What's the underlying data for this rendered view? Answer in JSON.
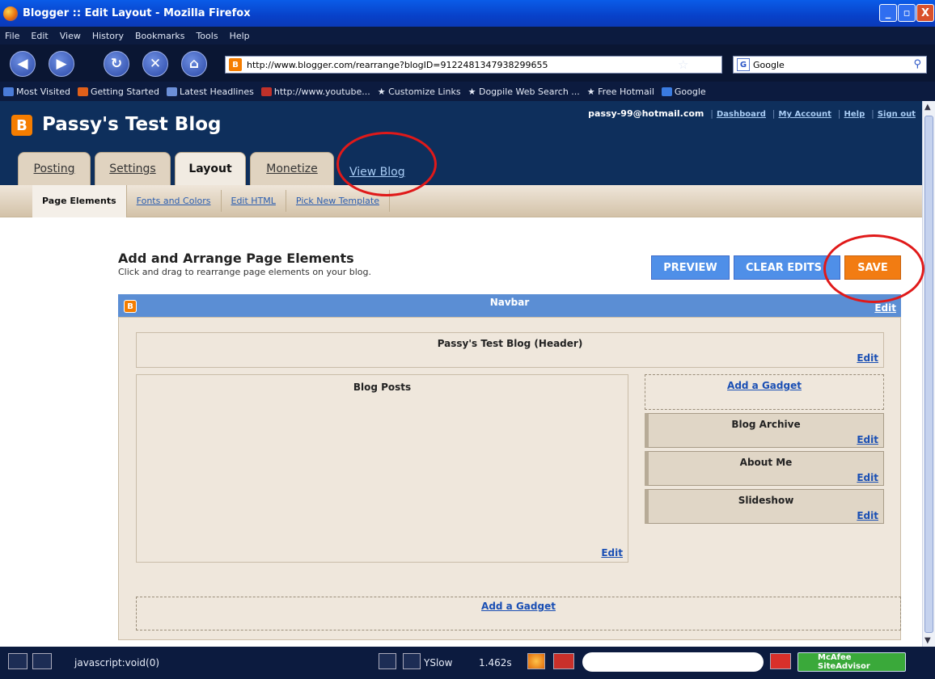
{
  "window": {
    "title": "Blogger :: Edit Layout - Mozilla Firefox",
    "controls": [
      "_",
      "▫",
      "X"
    ]
  },
  "menu": [
    "File",
    "Edit",
    "View",
    "History",
    "Bookmarks",
    "Tools",
    "Help"
  ],
  "nav": {
    "url": "http://www.blogger.com/rearrange?blogID=9122481347938299655",
    "search_engine": "Google"
  },
  "bookmarks": [
    {
      "label": "Most Visited",
      "color": "#4a7bd8"
    },
    {
      "label": "Getting Started",
      "color": "#e0601a"
    },
    {
      "label": "Latest Headlines",
      "color": "#6c8fd8"
    },
    {
      "label": "http://www.youtube...",
      "color": "#c0312a"
    },
    {
      "label": "Customize Links",
      "color": "#ffffff"
    },
    {
      "label": "Dogpile Web Search ...",
      "color": "#ffffff"
    },
    {
      "label": "Free Hotmail",
      "color": "#ffffff"
    },
    {
      "label": "Google",
      "color": "#3a7be0"
    }
  ],
  "blog": {
    "name": "Passy's Test Blog",
    "user_email": "passy-99@hotmail.com",
    "user_links": [
      "Dashboard",
      "My Account",
      "Help",
      "Sign out"
    ],
    "tabs": [
      "Posting",
      "Settings",
      "Layout",
      "Monetize"
    ],
    "view_blog": "View Blog",
    "subtabs": [
      "Page Elements",
      "Fonts and Colors",
      "Edit HTML",
      "Pick New Template"
    ]
  },
  "page": {
    "title": "Add and Arrange Page Elements",
    "subtitle": "Click and drag to rearrange page elements on your blog.",
    "buttons": {
      "preview": "PREVIEW",
      "clear": "CLEAR EDITS",
      "save": "SAVE"
    }
  },
  "layout": {
    "navbar_title": "Navbar",
    "header_title": "Passy's Test Blog (Header)",
    "posts_title": "Blog Posts",
    "add_gadget": "Add a Gadget",
    "edit": "Edit",
    "gadgets": [
      "Blog Archive",
      "About Me",
      "Slideshow"
    ]
  },
  "status": {
    "text": "javascript:void(0)",
    "yslow": "YSlow",
    "time": "1.462s",
    "mcafee": "McAfee SiteAdvisor"
  },
  "colors": {
    "accent": "#f57d00",
    "header": "#0e2f5c",
    "annotation": "#e01919"
  }
}
